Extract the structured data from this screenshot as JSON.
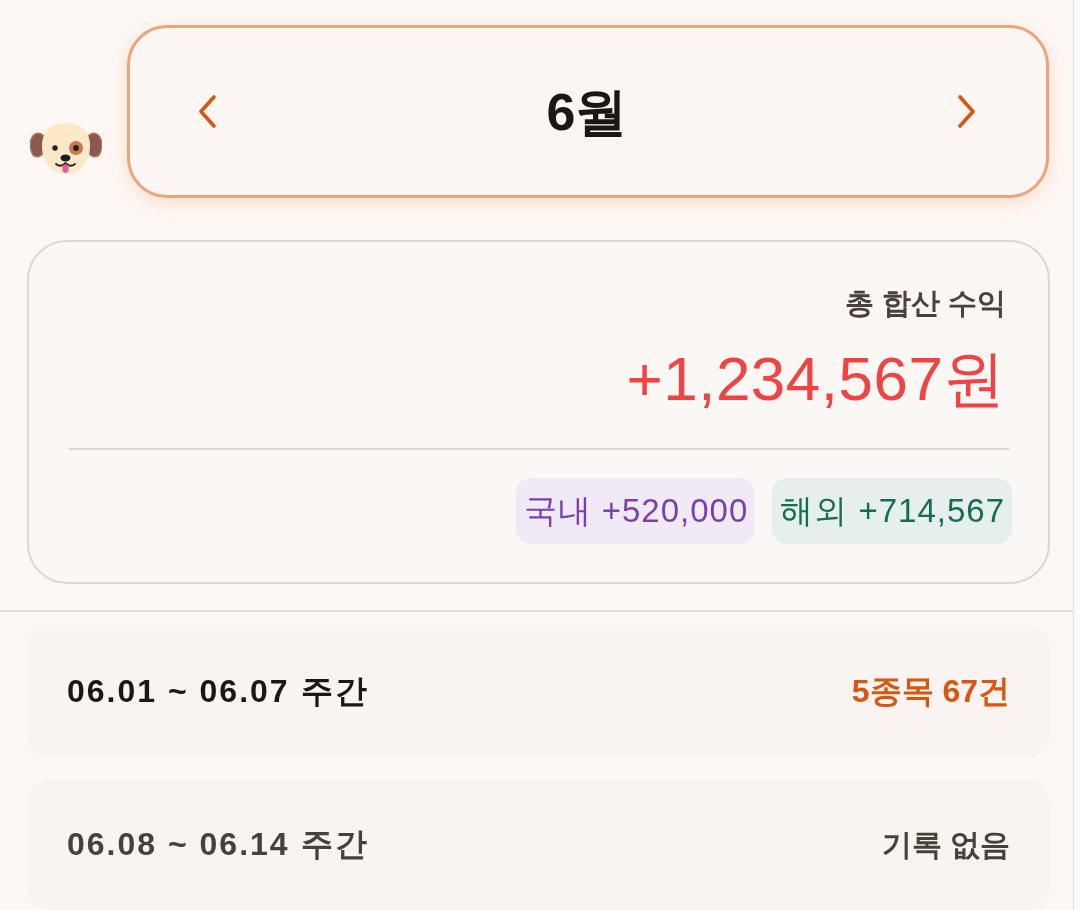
{
  "month_nav": {
    "title": "6월"
  },
  "summary": {
    "label": "총 합산 수익",
    "total": "+1,234,567원",
    "breakdown": [
      {
        "label": "국내 +520,000",
        "color": "#7b3fae"
      },
      {
        "label": "해외 +714,567",
        "color": "#166b56"
      }
    ]
  },
  "weeks": [
    {
      "range": "06.01 ~ 06.07 주간",
      "status": "5종목 67건",
      "has_records": true
    },
    {
      "range": "06.08 ~ 06.14 주간",
      "status": "기록 없음",
      "has_records": false
    }
  ]
}
